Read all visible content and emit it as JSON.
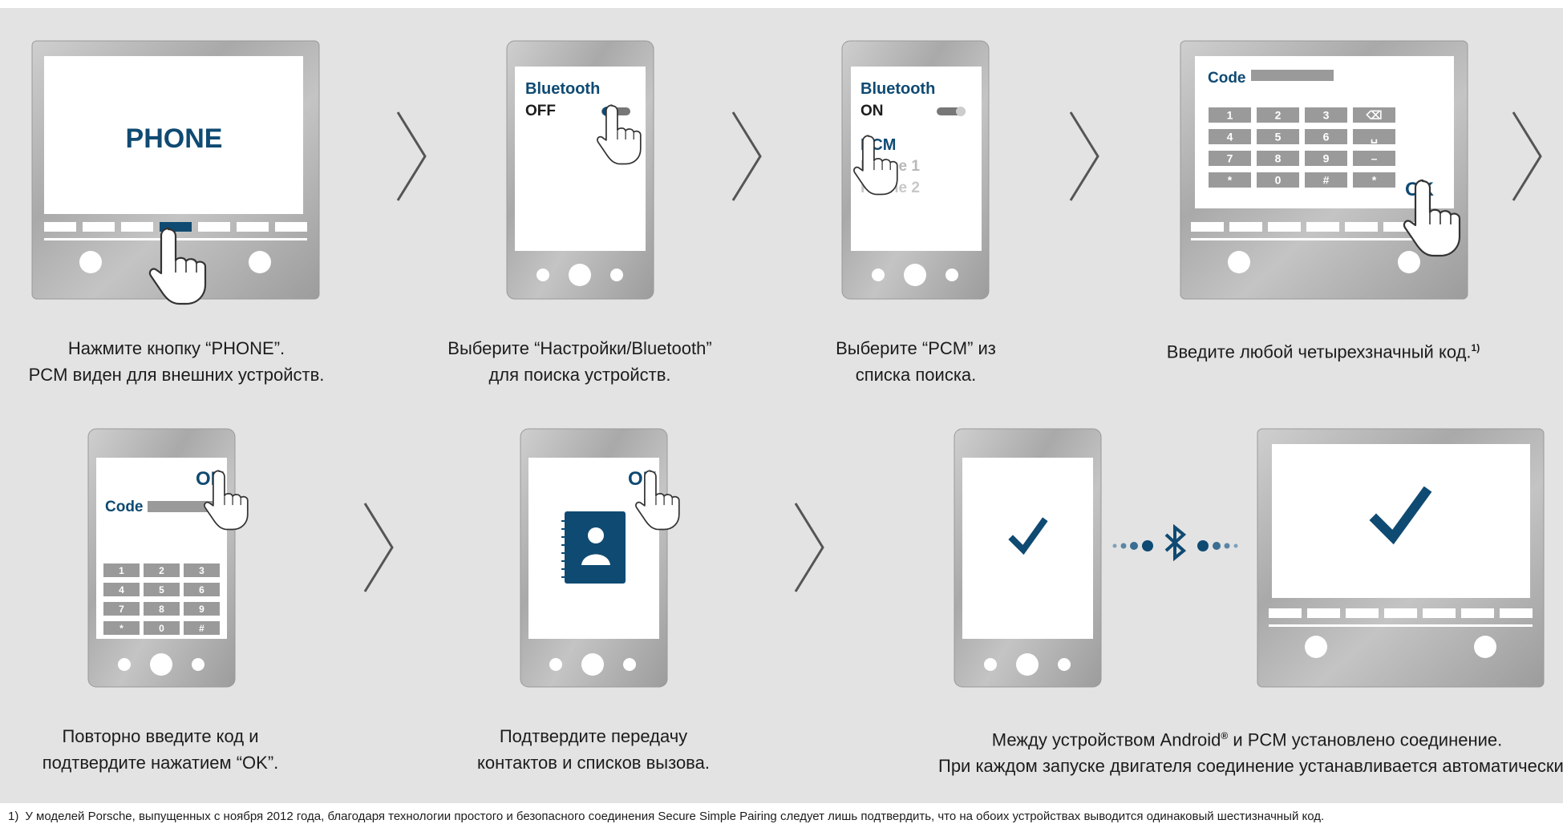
{
  "colors": {
    "accent": "#0f4a72",
    "panel_bg": "#e3e3e3",
    "metal": "#b9b9b9",
    "screen": "#ffffff",
    "key": "#9a9a9a",
    "chevron": "#555555"
  },
  "step1": {
    "screen_title": "PHONE",
    "caption_line1": "Нажмите кнопку “PHONE”.",
    "caption_line2": "PCM виден для внешних устройств."
  },
  "step2": {
    "screen_line1": "Bluetooth",
    "screen_line2": "OFF",
    "caption_line1": "Выберите “Настройки/Bluetooth”",
    "caption_line2": "для поиска устройств."
  },
  "step3": {
    "screen_line1": "Bluetooth",
    "screen_line2": "ON",
    "list_item_selected": "PCM",
    "list_item_2": "Phone 1",
    "list_item_3": "Phone 2",
    "caption_line1": "Выберите “PCM” из",
    "caption_line2": "списка поиска."
  },
  "step4": {
    "code_label": "Code",
    "keys": [
      "1",
      "2",
      "3",
      "⌫",
      "4",
      "5",
      "6",
      "␣",
      "7",
      "8",
      "9",
      "–",
      "*",
      "0",
      "#",
      "*"
    ],
    "ok_label": "OK",
    "caption_line1": "Введите любой четырехзначный код.",
    "caption_footnote_ref": "1)"
  },
  "step5": {
    "ok_label": "OK",
    "code_label": "Code",
    "keys": [
      "1",
      "2",
      "3",
      "4",
      "5",
      "6",
      "7",
      "8",
      "9",
      "*",
      "0",
      "#"
    ],
    "caption_line1": "Повторно введите код и",
    "caption_line2": "подтвердите нажатием “OK”."
  },
  "step6": {
    "ok_label": "OK",
    "icon": "contacts-book-icon",
    "caption_line1": "Подтвердите передачу",
    "caption_line2": "контактов и списков вызова."
  },
  "step7": {
    "icons": [
      "checkmark-icon",
      "bluetooth-icon",
      "checkmark-icon"
    ],
    "caption_line1": "Между устройством Android",
    "caption_reg": "®",
    "caption_line1_rest": " и PCM установлено соединение.",
    "caption_line2": "При каждом запуске двигателя соединение устанавливается автоматически."
  },
  "footnote": {
    "marker": "1)",
    "text": "У моделей Porsche, выпущенных с ноября 2012 года, благодаря технологии простого и безопасного соединения Secure Simple Pairing следует лишь подтвердить, что на обоих устройствах выводится одинаковый шестизначный код."
  }
}
